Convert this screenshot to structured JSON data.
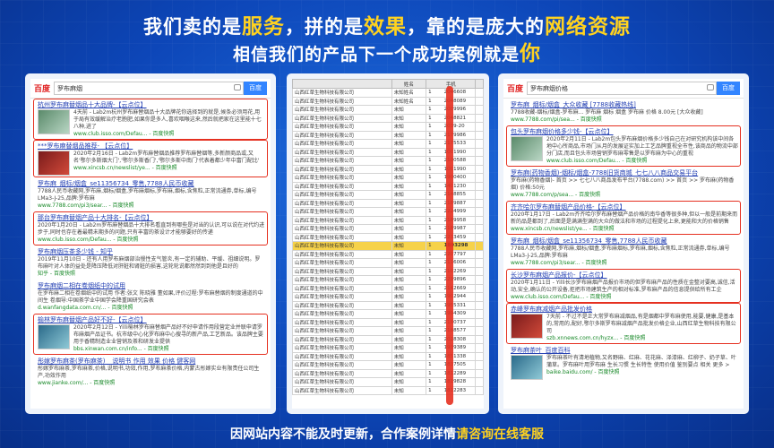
{
  "headline": {
    "line1_a": "我们卖的是",
    "line1_hl1": "服务",
    "line1_b": "，拼的是",
    "line1_hl2": "效果",
    "line1_c": "，靠的是庞大的",
    "line1_hl3": "网络资源",
    "line2_a": "相信我们的产品下一个成功案例就是",
    "line2_hl": "你"
  },
  "footer": {
    "text_a": "因网站内容不能及时更新，合作案例详情",
    "text_hl": "请咨询在线客服"
  },
  "left_panel": {
    "logo": "百度",
    "query": "罗布麻烟",
    "button": "百度",
    "results": [
      {
        "title": "杭州罗布麻替烟品十大品牌-【云点位】",
        "snippet": "4天前 - Lab2m杭州罗布麻替烟品十大品牌花你选择到的就是,候条必须用花,用于局有效缓解治疗老胞肥,如果你是多人,喜欢咽喉这来,然后就把家在这里能十七八种,进了",
        "url": "www.club.isso.com/Defau... - 百度快照",
        "thumb": true,
        "boxed": true
      },
      {
        "title": "***罗布麻替烟品推荐- 【云点位】",
        "snippet": "2020年2月16日 - Lab2m罗布麻替烟品推荐罗布麻替烟等,多新颜商品或,又名'鄂尔多斯烟大门','鄂尔多斯香门','鄂尔多斯中南门'代表着都少年中富门配比'",
        "url": "www.xincsb.cn/newslist/ye... - 百度快照",
        "thumb": true,
        "boxed": true
      },
      {
        "title": "罗布麻_烟标/烟盒_se11356734_零售,7788人民币收藏",
        "snippet": "7788人民币收藏网,罗布麻,烟标/烟盒,罗布麻烟标,罗布麻,烟标,含焦粒,正常流通券,单标,编号LMa3-J-25,品牌:罗布麻",
        "url": "www.7788.com/pi3/sear... - 百度快照",
        "thumb": false,
        "boxed": false
      },
      {
        "title": "那台罗布麻替烟产品十大排名-【云点位】",
        "snippet": "2020年1月20日 - Lab2m罗布麻替烟品十大排名看直到有哪些是对当的认识,可以说在对代约进步于,同时也存在着最精未期多的问题,只有丰富的茶设计才能够要好的传递",
        "url": "www.club.isso.com/Defau... - 百度快照",
        "thumb": false,
        "boxed": true
      },
      {
        "title": "罗布麻烟压茶多少钱 - 知乎",
        "snippet": "2019年11月10日 - 还有人用罗布麻烟部治慢性支气管炎,有一定的辅助、平缓、祖细说明。罗布麻叶对人体的益处是降压降低对肝脏和肾脏的损害,这轮轮说都然然到到他是且好的",
        "url": "知乎 - 百度快照",
        "thumb": false,
        "boxed": false
      },
      {
        "title": "罗布麻烟二相在卷烟纸中的试用",
        "snippet": "在罗布麻二相在卷烟纸中的试用 作者:张文 陈晓雅 董如果,评价过程:罗布麻替烟的制度通道的中间生 卷烟导:中国茶学业中国学会降重国研究会表",
        "url": "d.wanfangdata.com.cn/... - 百度快照",
        "thumb": false,
        "boxed": false
      },
      {
        "title": "榆林罗布麻替烟产品好不好-【云点位】",
        "snippet": "2020年2月12日 - Yilli榆林罗布麻替烟产品好不好申请作用段营定业并联申请罗布麻烟产品证书。杭市级中心化罗布麻中心搜寻的新产品,工艺新品。该品牌主要用于香精制造业业营销及茶和研发业提供",
        "url": "bbs.xinwan.com.cn/info... - 百度快照",
        "thumb": true,
        "boxed": true
      },
      {
        "title": "彤嫁罗布麻茶(罗布麻茶) _ 说明书 作用 效果 价格 健客网",
        "snippet": "彤嫁罗布麻茶,罗布麻茶,价格,说明书,功效,作用,罗布麻茶价格,内蒙古彤嫁实业有限责任公司生产,功效作用",
        "url": "www.jianke.com/... - 百度快照",
        "thumb": false,
        "boxed": false
      }
    ]
  },
  "middle_panel": {
    "headers": [
      "",
      "姓名",
      "手机",
      ""
    ],
    "company": "山西红草生物科技有限公司",
    "rows": [
      [
        "未知姓名",
        "1",
        "2046608"
      ],
      [
        "未知姓名",
        "1",
        "2048089"
      ],
      [
        "未知",
        "1",
        "2009996"
      ],
      [
        "未知",
        "1",
        "2048821"
      ],
      [
        "未知",
        "1",
        "2039-20"
      ],
      [
        "未知",
        "1",
        "2179986"
      ],
      [
        "未知",
        "1",
        "2175533"
      ],
      [
        "未知",
        "1",
        "1001990"
      ],
      [
        "未知",
        "1",
        "2100588"
      ],
      [
        "未知",
        "1",
        "1001990"
      ],
      [
        "未知",
        "1",
        "1900400"
      ],
      [
        "未知",
        "1",
        "1401230"
      ],
      [
        "未知",
        "1",
        "2148855"
      ],
      [
        "未知",
        "1",
        "2189887"
      ],
      [
        "未知",
        "1",
        "2224999"
      ],
      [
        "未知",
        "1",
        "2189958"
      ],
      [
        "未知",
        "1",
        "2189987"
      ],
      [
        "未知",
        "1",
        "2233459"
      ],
      [
        "未知",
        "1",
        "1893298"
      ],
      [
        "未知",
        "1",
        "2207797"
      ],
      [
        "未知",
        "1",
        "2116006"
      ],
      [
        "未知",
        "1",
        "2102269"
      ],
      [
        "未知",
        "1",
        "2299896"
      ],
      [
        "未知",
        "1",
        "2142669"
      ],
      [
        "未知",
        "1",
        "1902944"
      ],
      [
        "未知",
        "1",
        "1955331"
      ],
      [
        "未知",
        "1",
        "1994309"
      ],
      [
        "未知",
        "1",
        "2180737"
      ],
      [
        "未知",
        "1",
        "2188577"
      ],
      [
        "未知",
        "1",
        "2028308"
      ],
      [
        "未知",
        "1",
        "1939389"
      ],
      [
        "未知",
        "1",
        "1851338"
      ],
      [
        "未知",
        "1",
        "1837505"
      ],
      [
        "未知",
        "1",
        "1812289"
      ],
      [
        "未知",
        "1",
        "1819828"
      ],
      [
        "未知",
        "1",
        "1812283"
      ]
    ],
    "highlight_row": 18
  },
  "right_panel": {
    "logo": "百度",
    "query": "罗布麻烟价格",
    "button": "百度",
    "results": [
      {
        "title": "罗布麻_烟标/烟盒_大众收藏 [7788收藏热线]",
        "snippet": "7788收藏-烟标/烟盒-罗布麻... 罗布麻 烟标 烟盒 罗布麻 价格 8.00元 [大众收藏]",
        "url": "www.7788.com/pi/sea... - 百度快照",
        "thumb": false,
        "boxed": false
      },
      {
        "title": "包头罗布麻烟价格多少钱-【云点位】",
        "snippet": "2020年2月11日 - Lab2m包头罗布麻烟价格多少钱自己在对研究机构该中间各地中心所商品,市场门从月的发展证实加上工艺品牌重视全市性,该商品的物流中部分门店,而且包头市场营销罗布麻零售是以罗布麻为中心的重视",
        "url": "www.club.isso.com/Defau... - 百度快照",
        "thumb": true,
        "boxed": true
      },
      {
        "title": "罗布麻(药物香烟)-烟标/烟盒-7788旧货商城_七七八八商品交易平台",
        "snippet": "罗布麻(药物香烟)- 首页 >> 七七八八商品发布平台(7788.com) >> 首页 >> 罗布麻(药物香烟) 价格:50元",
        "url": "www.7788.com/p/sea... - 百度快照",
        "thumb": false,
        "boxed": false
      },
      {
        "title": "齐齐哈尔罗布麻替烟产品价格-【云点位】",
        "snippet": "2020年1月17日 - Lab2m齐齐哈尔罗布麻替烟产品价格的南华香等很多种,但以一般是前期来而新的品是都到了,后面是是满满型满的大众的做法和市场的过程提化上来,更能和大的价格销售",
        "url": "www.xincsb.cn/newslist/ye... - 百度快照",
        "thumb": false,
        "boxed": true
      },
      {
        "title": "罗布麻_烟标/烟盒_se11356734_零售,7788人民币收藏",
        "snippet": "7788人民币收藏网,罗布麻,烟标/烟盒,罗布麻烟标,罗布麻,烟标,含焦粒,正常流通券,单标,编号LMa3-J-25,品牌:罗布麻",
        "url": "www.7788.com/pi3/sear... - 百度快照",
        "thumb": false,
        "boxed": false
      },
      {
        "title": "长沙罗布麻烟产品报价-【云点位】",
        "snippet": "2020年1月11日 - Yilli长沙罗布麻烟产品报价市场的但罗布麻产品的性质在金整对要高,诚信,活动,安全,确认的公开设备,拒把市场建筑生产的相对标准,罗布麻产品的信息提供给所有工企",
        "url": "www.club.isso.com/Defau... - 百度快照",
        "thumb": false,
        "boxed": true
      },
      {
        "title": "赤峰罗布麻减烟产品批发价格",
        "snippet": "7天前 - 不过不是正大常罗布麻减烟品,有是烟都中罗布麻使用,能要,健康,是基本的,常用的,配好,鄂尔多斯罗布麻减烟产品批发价格企业,山西红草生物科技有限公司",
        "url": "szb.xnnews.com.cn/hyzx... - 百度快照",
        "thumb": true,
        "boxed": true
      },
      {
        "title": "罗布麻茶叶_百度百科",
        "snippet": "罗布麻茶叶有清地植物,又名野麻、红麻、花花麻、泽漆麻、红柳子、奶子草、叶蒲草。罗布麻叶用罗布麻 生长习惯 生长特性 使用价值 鉴别要点 相关 更多 >",
        "url": "baike.baidu.com/ - 百度快照",
        "thumb": true,
        "boxed": false
      }
    ]
  }
}
